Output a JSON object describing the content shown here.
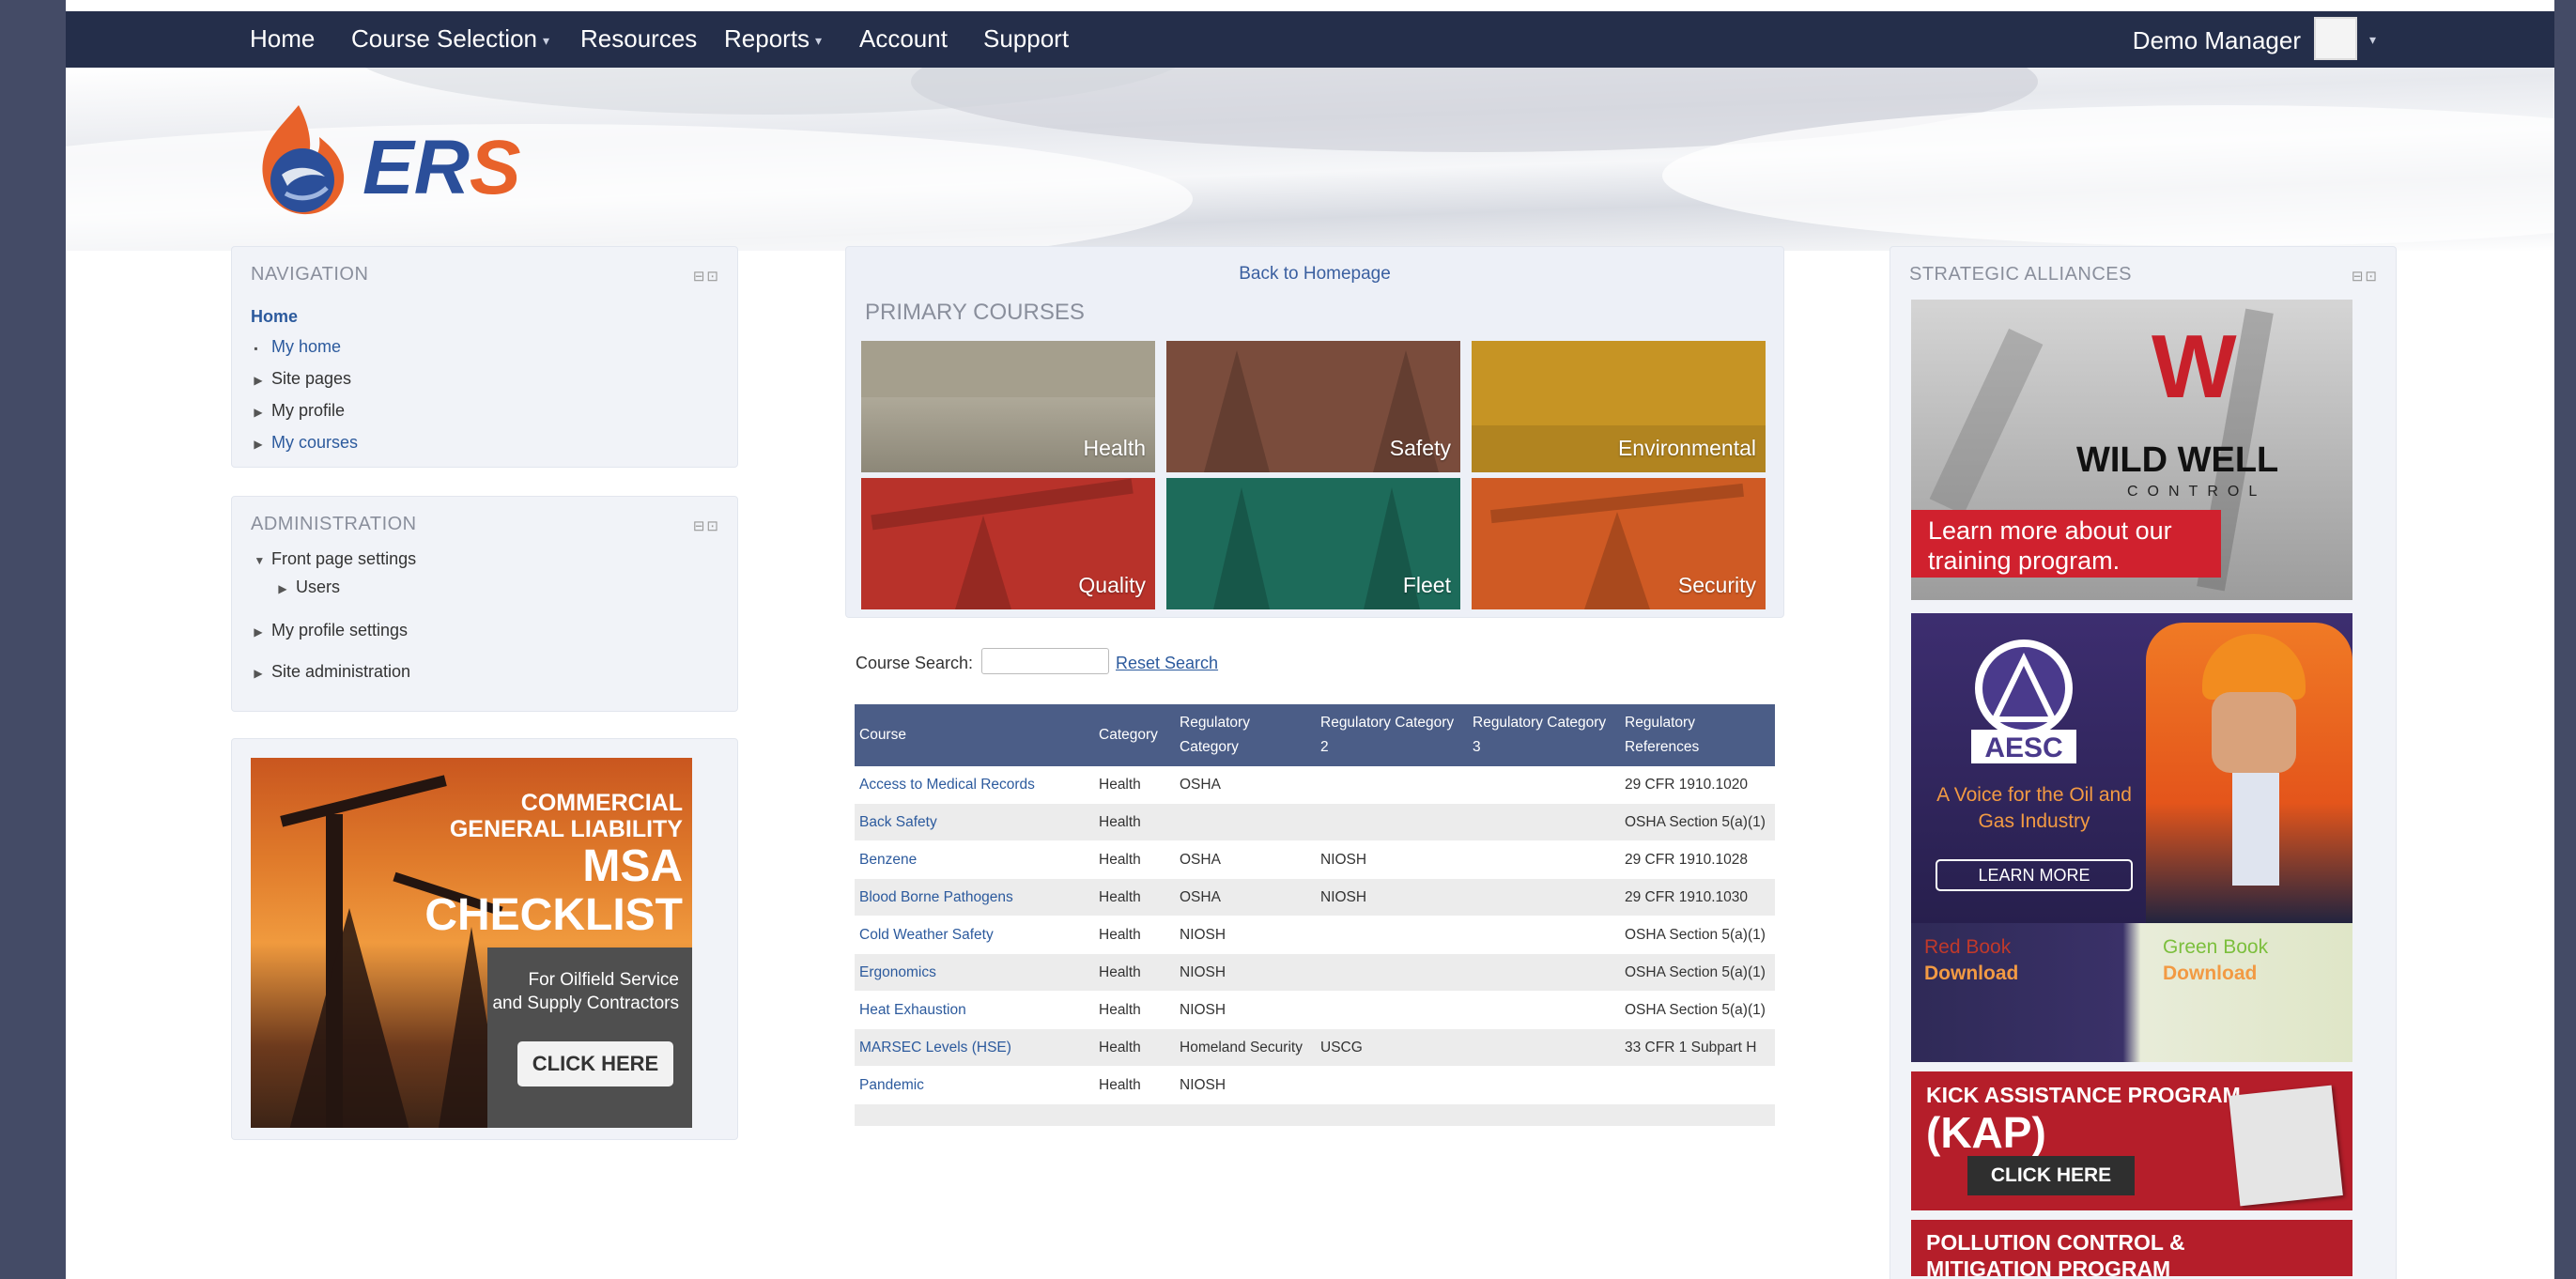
{
  "topnav": {
    "items": [
      "Home",
      "Course Selection",
      "Resources",
      "Reports",
      "Account",
      "Support"
    ],
    "user": "Demo Manager"
  },
  "logo": {
    "text": "ERS"
  },
  "navigation": {
    "title": "NAVIGATION",
    "home": "Home",
    "items": [
      "My home",
      "Site pages",
      "My profile",
      "My courses"
    ]
  },
  "administration": {
    "title": "ADMINISTRATION",
    "items": [
      "Front page settings",
      "Users",
      "My profile settings",
      "Site administration"
    ]
  },
  "ad": {
    "line1": "COMMERCIAL",
    "line2": "GENERAL LIABILITY",
    "line3": "MSA",
    "line4": "CHECKLIST",
    "sub1": "For Oilfield Service",
    "sub2": "and Supply Contractors",
    "button": "CLICK HERE"
  },
  "main": {
    "back_link": "Back to Homepage",
    "primary_title": "PRIMARY COURSES",
    "tiles": [
      {
        "label": "Health",
        "color": "#a59f8d"
      },
      {
        "label": "Safety",
        "color": "#7a4c3c"
      },
      {
        "label": "Environmental",
        "color": "#c69424"
      },
      {
        "label": "Quality",
        "color": "#b8322a"
      },
      {
        "label": "Fleet",
        "color": "#1d6b5a"
      },
      {
        "label": "Security",
        "color": "#cf5a24"
      }
    ],
    "search_label": "Course Search:",
    "search_value": "",
    "reset_label": "Reset Search"
  },
  "table": {
    "headers": [
      "Course",
      "Category",
      "Regulatory Category",
      "Regulatory Category 2",
      "Regulatory Category 3",
      "Regulatory References"
    ],
    "rows": [
      [
        "Access to Medical Records",
        "Health",
        "OSHA",
        "",
        "",
        "29 CFR 1910.1020"
      ],
      [
        "Back Safety",
        "Health",
        "",
        "",
        "",
        "OSHA Section 5(a)(1)"
      ],
      [
        "Benzene",
        "Health",
        "OSHA",
        "NIOSH",
        "",
        "29 CFR 1910.1028"
      ],
      [
        "Blood Borne Pathogens",
        "Health",
        "OSHA",
        "NIOSH",
        "",
        "29 CFR 1910.1030"
      ],
      [
        "Cold Weather Safety",
        "Health",
        "NIOSH",
        "",
        "",
        "OSHA Section 5(a)(1)"
      ],
      [
        "Ergonomics",
        "Health",
        "NIOSH",
        "",
        "",
        "OSHA Section 5(a)(1)"
      ],
      [
        "Heat Exhaustion",
        "Health",
        "NIOSH",
        "",
        "",
        "OSHA Section 5(a)(1)"
      ],
      [
        "MARSEC Levels (HSE)",
        "Health",
        "Homeland Security",
        "USCG",
        "",
        "33 CFR 1 Subpart H"
      ],
      [
        "Pandemic",
        "Health",
        "NIOSH",
        "",
        "",
        ""
      ]
    ]
  },
  "alliances": {
    "title": "STRATEGIC ALLIANCES",
    "wildwell_name": "WILD WELL",
    "wildwell_control": "CONTROL",
    "wildwell_banner": "Learn more about our training program.",
    "aesc_name": "AESC",
    "aesc_tagline": "A Voice for the Oil and Gas Industry",
    "aesc_button": "LEARN MORE",
    "redbook_title": "Red Book",
    "redbook_action": "Download",
    "greenbook_title": "Green Book",
    "greenbook_action": "Download",
    "kap_title": "KICK ASSISTANCE PROGRAM",
    "kap_abbr": "(KAP)",
    "kap_button": "CLICK HERE",
    "pollution_title": "POLLUTION CONTROL &",
    "pollution_title2": "MITIGATION PROGRAM"
  },
  "colors": {
    "topbar": "#242e4a",
    "table_header": "#4b5d87",
    "link": "#2c5a9d",
    "logo_orange": "#e8622a",
    "logo_blue": "#2b4f9a"
  }
}
